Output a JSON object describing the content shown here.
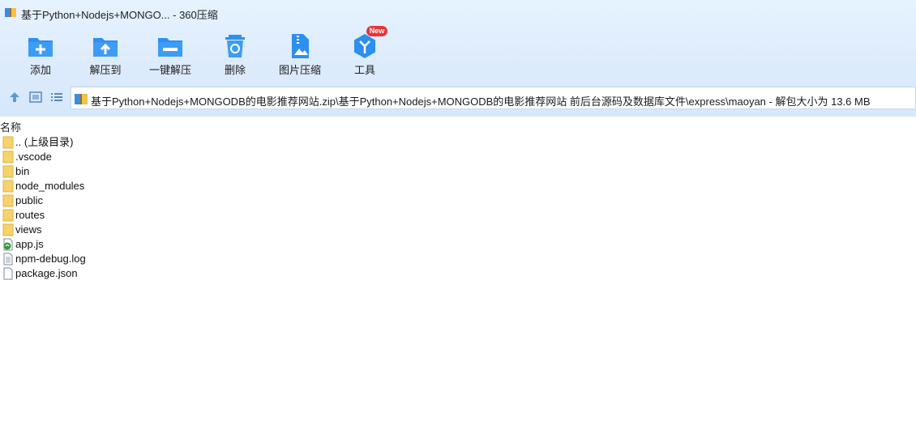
{
  "window": {
    "title": "基于Python+Nodejs+MONGO... - 360压缩"
  },
  "toolbar": {
    "items": [
      {
        "label": "添加",
        "icon": "add-folder-icon"
      },
      {
        "label": "解压到",
        "icon": "extract-to-icon"
      },
      {
        "label": "一键解压",
        "icon": "one-click-extract-icon"
      },
      {
        "label": "删除",
        "icon": "delete-recycle-icon"
      },
      {
        "label": "图片压缩",
        "icon": "image-compress-icon"
      },
      {
        "label": "工具",
        "icon": "tools-cube-icon"
      }
    ],
    "new_badge": "New"
  },
  "navigation": {
    "path": "基于Python+Nodejs+MONGODB的电影推荐网站.zip\\基于Python+Nodejs+MONGODB的电影推荐网站 前后台源码及数据库文件\\express\\maoyan - 解包大小为 13.6 MB"
  },
  "list": {
    "header": "名称",
    "items": [
      {
        "name": ".. (上级目录)",
        "type": "folder"
      },
      {
        "name": ".vscode",
        "type": "folder"
      },
      {
        "name": "bin",
        "type": "folder"
      },
      {
        "name": "node_modules",
        "type": "folder"
      },
      {
        "name": "public",
        "type": "folder"
      },
      {
        "name": "routes",
        "type": "folder"
      },
      {
        "name": "views",
        "type": "folder"
      },
      {
        "name": "app.js",
        "type": "js"
      },
      {
        "name": "npm-debug.log",
        "type": "text"
      },
      {
        "name": "package.json",
        "type": "file"
      }
    ]
  },
  "colors": {
    "accent": "#2d8ff0",
    "folder": "#f7d36b",
    "badge": "#e8343a"
  }
}
